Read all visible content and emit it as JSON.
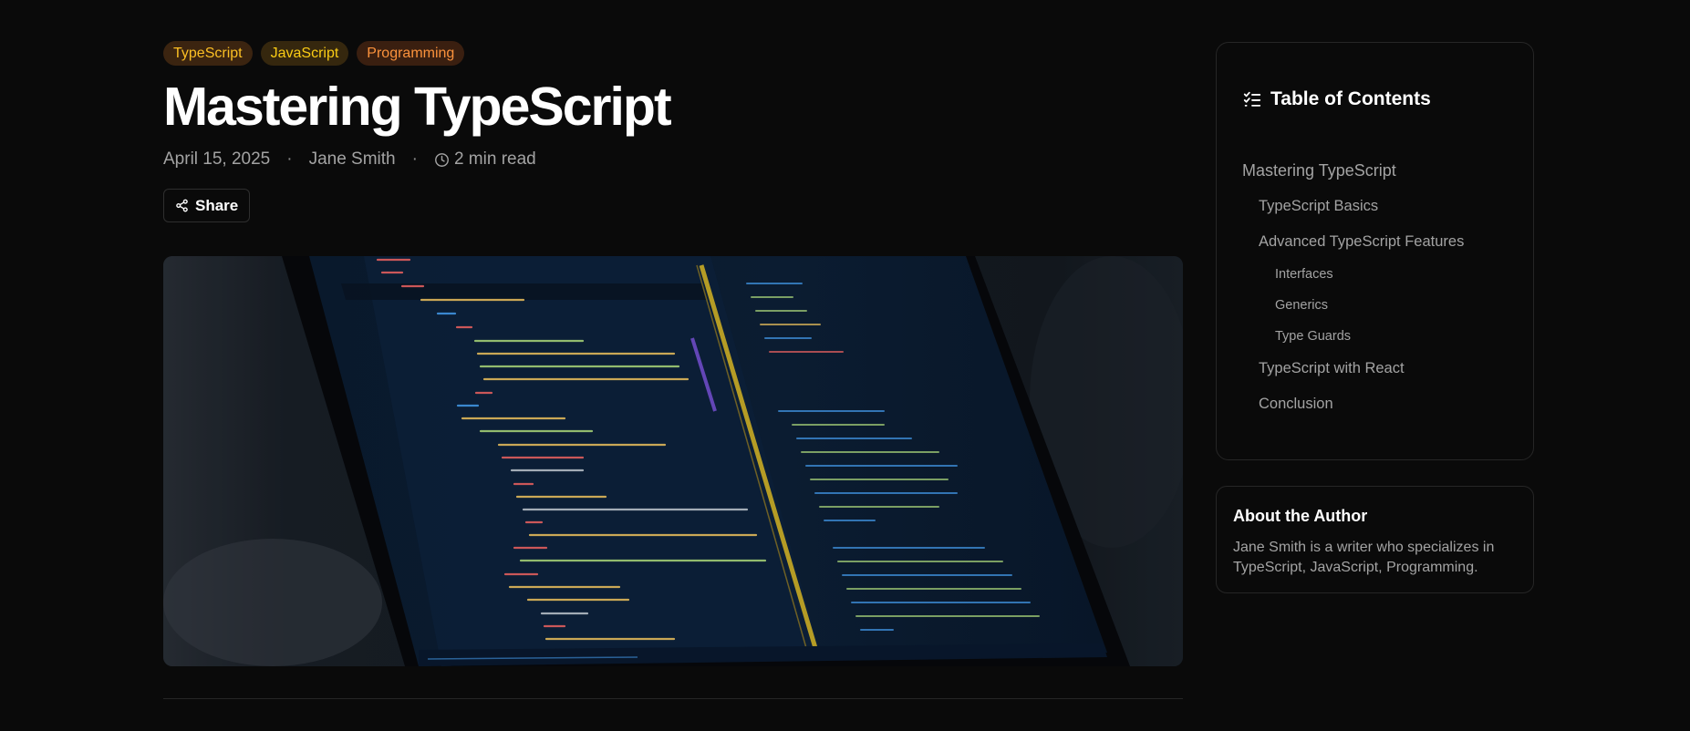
{
  "article": {
    "tags": [
      "TypeScript",
      "JavaScript",
      "Programming"
    ],
    "title": "Mastering TypeScript",
    "date": "April 15, 2025",
    "author": "Jane Smith",
    "read_time": "2 min read",
    "separator": "·",
    "share_label": "Share",
    "icons": {
      "share": "share-icon",
      "clock": "clock-icon"
    }
  },
  "toc": {
    "title": "Table of Contents",
    "icon": "list-checks-icon",
    "items": [
      {
        "label": "Mastering TypeScript",
        "level": 1
      },
      {
        "label": "TypeScript Basics",
        "level": 2
      },
      {
        "label": "Advanced TypeScript Features",
        "level": 2
      },
      {
        "label": "Interfaces",
        "level": 3
      },
      {
        "label": "Generics",
        "level": 3
      },
      {
        "label": "Type Guards",
        "level": 3
      },
      {
        "label": "TypeScript with React",
        "level": 2
      },
      {
        "label": "Conclusion",
        "level": 2
      }
    ]
  },
  "about_author": {
    "title": "About the Author",
    "bio": "Jane Smith is a writer who specializes in TypeScript, JavaScript, Programming."
  },
  "colors": {
    "background": "#0a0a0a",
    "border": "#262626",
    "tag_typescript_text": "#fbbf24",
    "tag_javascript_text": "#facc15",
    "tag_programming_text": "#fb923c",
    "muted_text": "#a3a3a3"
  }
}
